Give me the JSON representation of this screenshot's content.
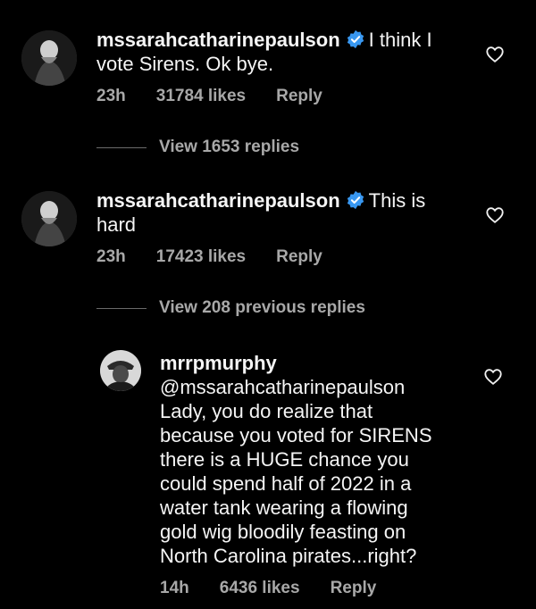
{
  "comments": [
    {
      "username": "mssarahcatharinepaulson",
      "text_first": "I think I",
      "text_rest": "vote Sirens. Ok bye.",
      "time": "23h",
      "likes": "31784 likes",
      "reply": "Reply",
      "view_replies": "View 1653 replies"
    },
    {
      "username": "mssarahcatharinepaulson",
      "text_first": "This is",
      "text_rest": "hard",
      "time": "23h",
      "likes": "17423 likes",
      "reply": "Reply",
      "view_replies": "View 208 previous replies"
    }
  ],
  "reply": {
    "username": "mrrpmurphy",
    "lines": [
      "@mssarahcatharinepaulson",
      "Lady, you do realize that",
      "because you voted for SIRENS",
      "there is a HUGE chance you",
      "could spend half of 2022 in a",
      "water tank wearing a flowing",
      "gold wig bloodily feasting on",
      "North Carolina pirates...right?"
    ],
    "time": "14h",
    "likes": "6436 likes",
    "reply": "Reply"
  },
  "icons": {
    "verified": "verified-badge-icon",
    "heart": "heart-outline-icon"
  },
  "colors": {
    "background": "#000000",
    "text": "#f5f5f5",
    "meta": "#a8a8a8",
    "verified": "#3897f0"
  }
}
